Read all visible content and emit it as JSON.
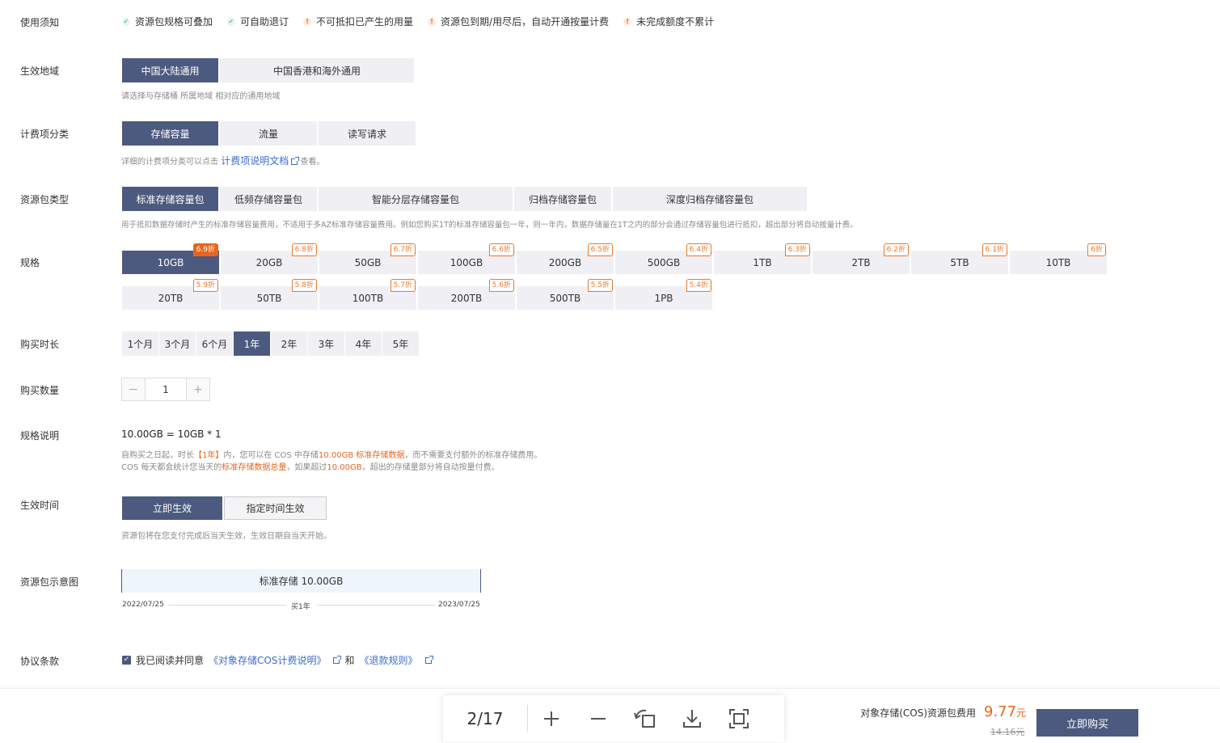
{
  "notice": {
    "label": "使用须知",
    "items": [
      {
        "text": "资源包规格可叠加",
        "type": "check"
      },
      {
        "text": "可自助退订",
        "type": "check"
      },
      {
        "text": "不可抵扣已产生的用量",
        "type": "warn"
      },
      {
        "text": "资源包到期/用尽后，自动开通按量计费",
        "type": "warn"
      },
      {
        "text": "未完成额度不累计",
        "type": "warn"
      }
    ]
  },
  "region": {
    "label": "生效地域",
    "options": [
      "中国大陆通用",
      "中国香港和海外通用"
    ],
    "hint": "请选择与存储桶 所属地域 相对应的通用地域"
  },
  "billing": {
    "label": "计费项分类",
    "options": [
      "存储容量",
      "流量",
      "读写请求"
    ],
    "hint_prefix": "详细的计费项分类可以点击",
    "hint_link": "计费项说明文档",
    "hint_suffix": "查看。"
  },
  "pkg_type": {
    "label": "资源包类型",
    "options": [
      "标准存储容量包",
      "低频存储容量包",
      "智能分层存储容量包",
      "归档存储容量包",
      "深度归档存储容量包"
    ],
    "hint": "用于抵扣数据存储时产生的标准存储容量费用，不适用于多AZ标准存储容量费用。例如您购买1T的标准存储容量包一年，则一年内，数据存储量在1T之内的部分会通过存储容量包进行抵扣，超出部分将自动按量计费。"
  },
  "spec": {
    "label": "规格",
    "items": [
      {
        "size": "10GB",
        "discount": "6.9折"
      },
      {
        "size": "20GB",
        "discount": "6.8折"
      },
      {
        "size": "50GB",
        "discount": "6.7折"
      },
      {
        "size": "100GB",
        "discount": "6.6折"
      },
      {
        "size": "200GB",
        "discount": "6.5折"
      },
      {
        "size": "500GB",
        "discount": "6.4折"
      },
      {
        "size": "1TB",
        "discount": "6.3折"
      },
      {
        "size": "2TB",
        "discount": "6.2折"
      },
      {
        "size": "5TB",
        "discount": "6.1折"
      },
      {
        "size": "10TB",
        "discount": "6折"
      },
      {
        "size": "20TB",
        "discount": "5.9折"
      },
      {
        "size": "50TB",
        "discount": "5.8折"
      },
      {
        "size": "100TB",
        "discount": "5.7折"
      },
      {
        "size": "200TB",
        "discount": "5.6折"
      },
      {
        "size": "500TB",
        "discount": "5.5折"
      },
      {
        "size": "1PB",
        "discount": "5.4折"
      }
    ]
  },
  "duration": {
    "label": "购买时长",
    "options": [
      "1个月",
      "3个月",
      "6个月",
      "1年",
      "2年",
      "3年",
      "4年",
      "5年"
    ]
  },
  "quantity": {
    "label": "购买数量",
    "minus": "−",
    "value": "1",
    "plus": "+"
  },
  "spec_desc": {
    "label": "规格说明",
    "formula": "10.00GB = 10GB * 1",
    "line1": {
      "a": "自购买之日起，时长",
      "b": "【1年】",
      "c": "内，您可以在 COS 中存储",
      "d": "10.00GB 标准存储数据",
      "e": "，而不需要支付额外的标准存储费用。"
    },
    "line2": {
      "a": "COS 每天都会统计您当天的",
      "b": "标准存储数据总量",
      "c": "，如果超过",
      "d": "10.00GB",
      "e": "，超出的存储量部分将自动按量付费。"
    }
  },
  "effective": {
    "label": "生效时间",
    "options": [
      "立即生效",
      "指定时间生效"
    ],
    "hint": "资源包将在您支付完成后当天生效，生效日期自当天开始。"
  },
  "diagram": {
    "label": "资源包示意图",
    "bar": "标准存储 10.00GB",
    "start": "2022/07/25",
    "mid": "买1年",
    "end": "2023/07/25"
  },
  "agreement": {
    "label": "协议条款",
    "check": "✓",
    "prefix": "我已阅读并同意",
    "link1": "《对象存储COS计费说明》",
    "and": "和",
    "link2": "《退款规则》"
  },
  "viewer": {
    "pages": "2/17"
  },
  "footer": {
    "price_label": "对象存储(COS)资源包费用",
    "price": "9.77",
    "unit": "元",
    "orig_price": "14.16元",
    "buy": "立即购买"
  }
}
